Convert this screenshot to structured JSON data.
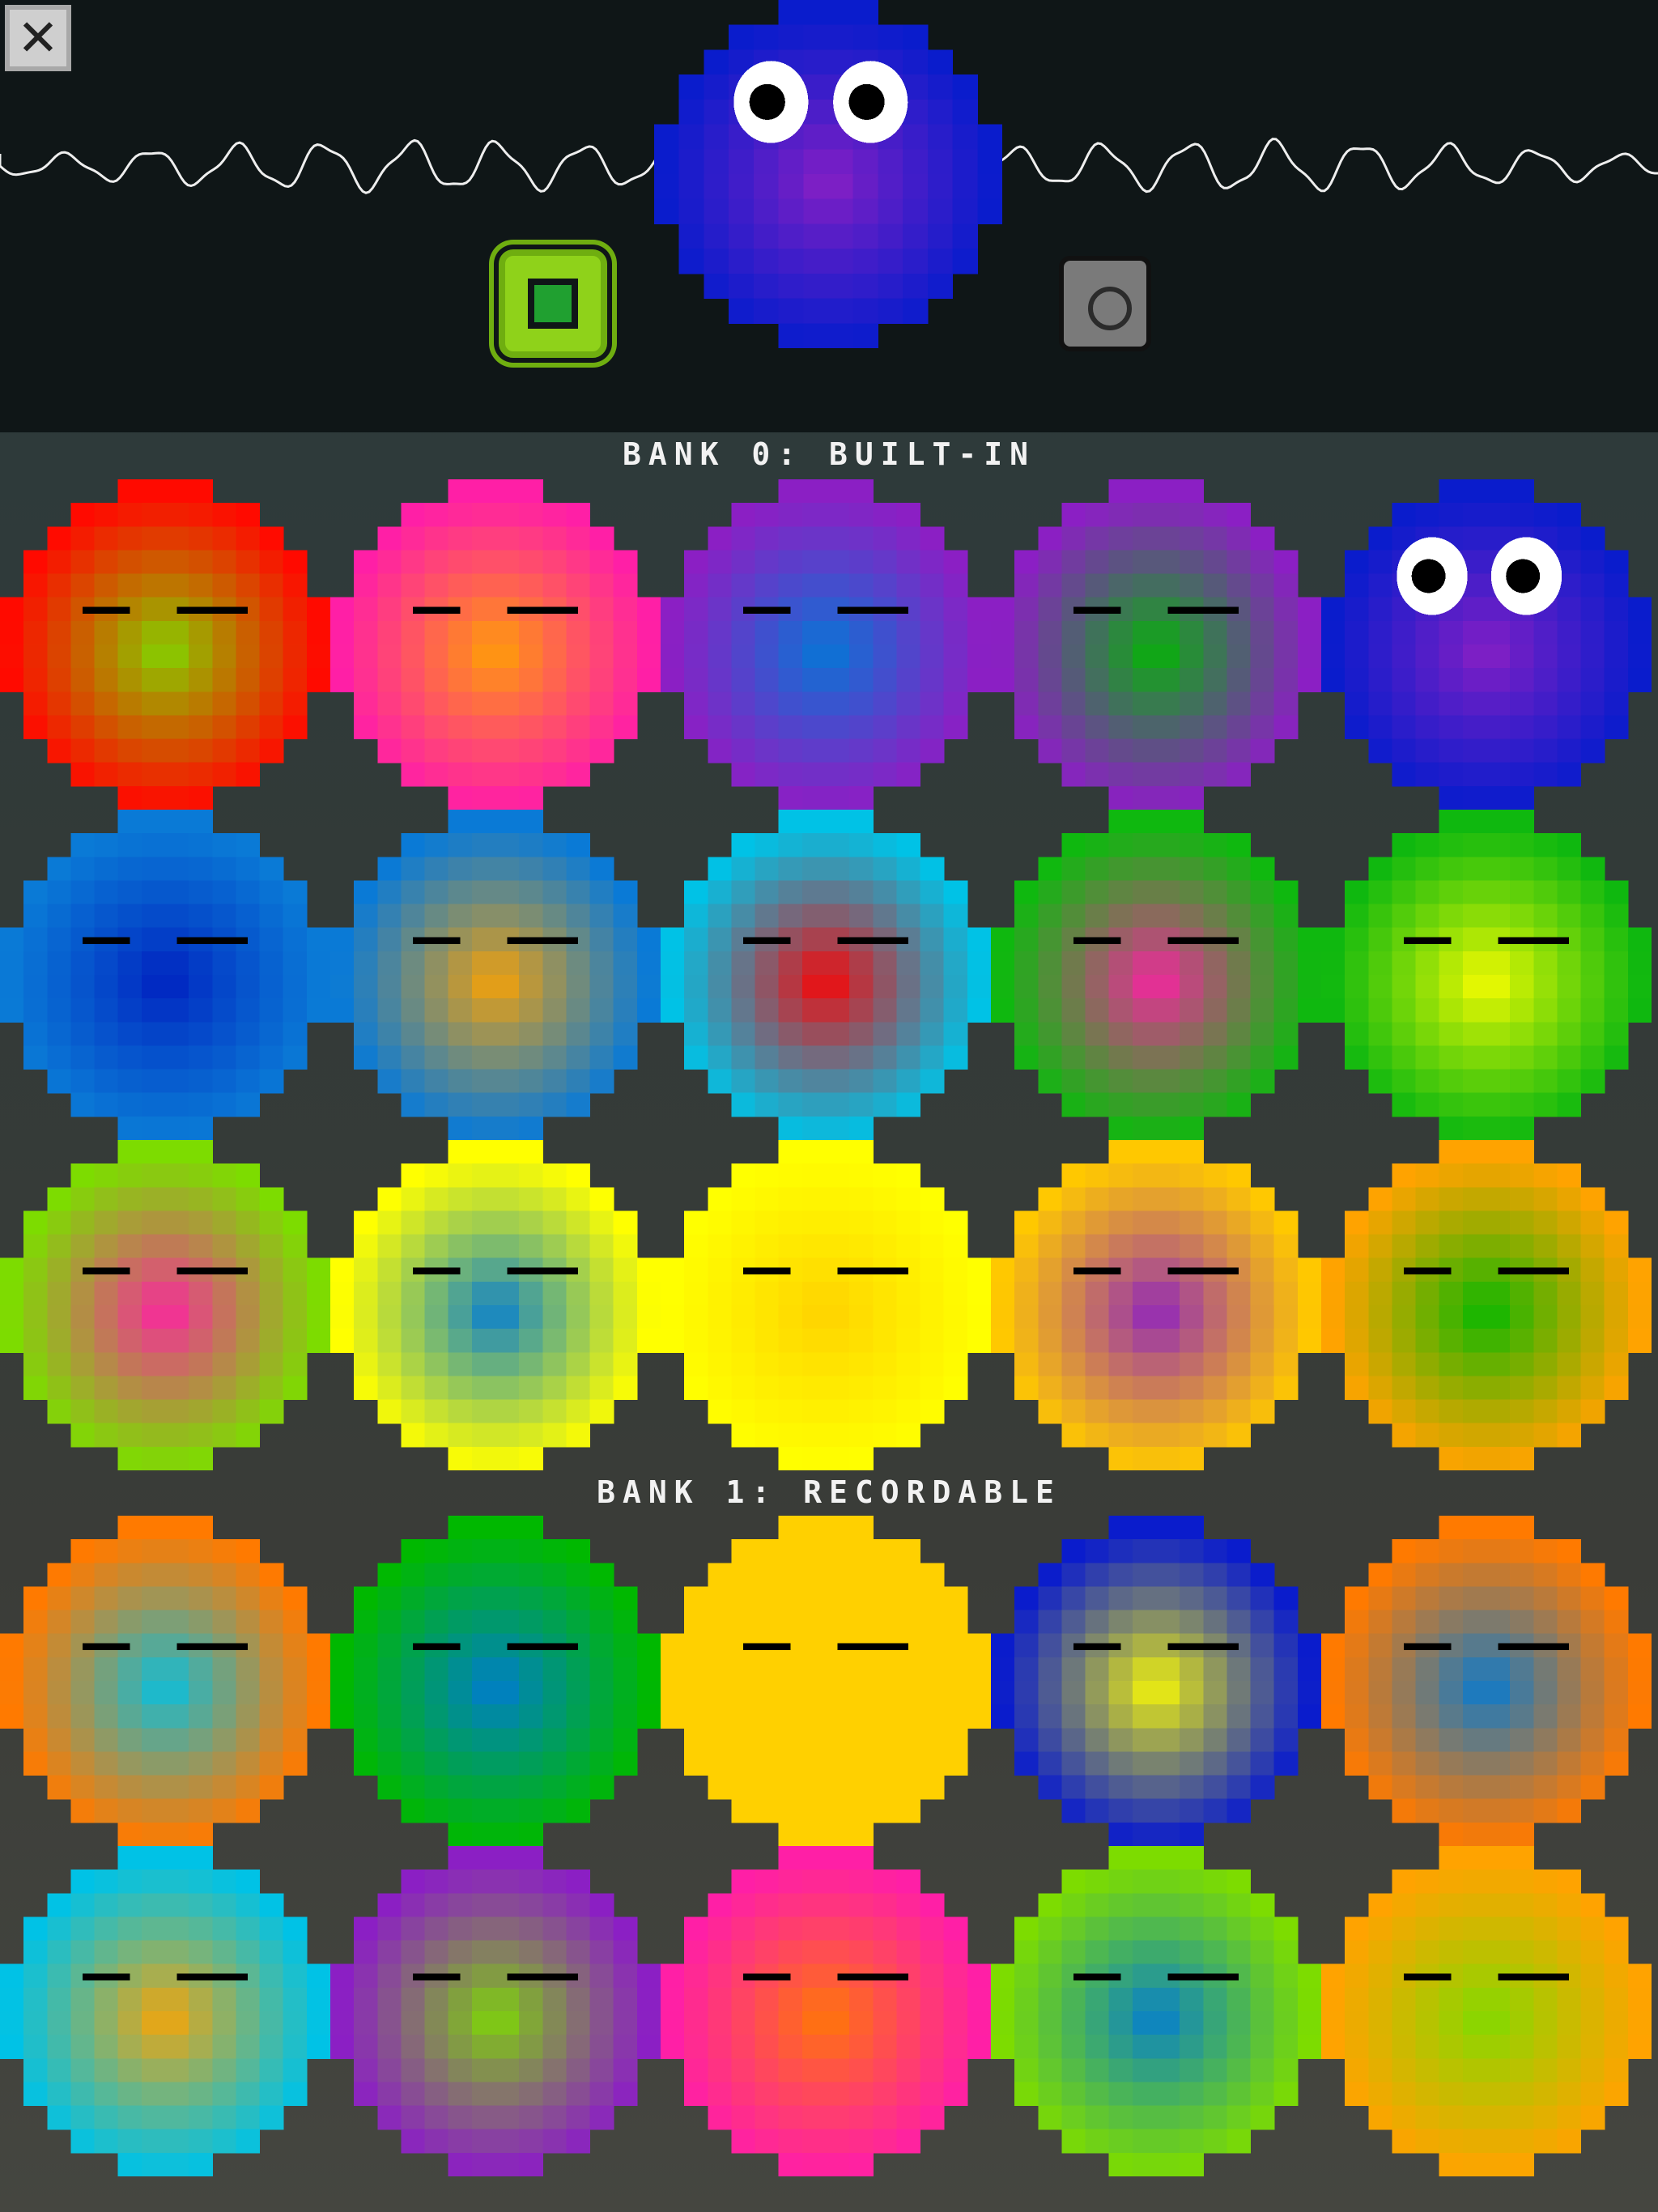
{
  "header": {
    "close_button": {
      "glyph": "✕",
      "icon": "close-icon"
    },
    "stop_button": {
      "icon": "stop-icon",
      "color": "#8fd21a"
    },
    "record_button": {
      "icon": "record-icon",
      "color": "#7a7a7a"
    },
    "active_sound": {
      "outer": "#0a1ccc",
      "inner": "#8b1fc4",
      "eyes": true
    }
  },
  "banks": [
    {
      "title": "BANK 0: BUILT-IN",
      "sounds": [
        {
          "outer": "#ff0a00",
          "inner": "#7ddc00",
          "eyes": false
        },
        {
          "outer": "#ff1fa6",
          "inner": "#ffa300",
          "eyes": false
        },
        {
          "outer": "#8b1fc4",
          "inner": "#007ad6",
          "eyes": false
        },
        {
          "outer": "#8b1fc4",
          "inner": "#00b800",
          "eyes": false
        },
        {
          "outer": "#0a1ccc",
          "inner": "#8b1fc4",
          "eyes": true
        },
        {
          "outer": "#0a7ad6",
          "inner": "#001fbf",
          "eyes": false
        },
        {
          "outer": "#0a7ad6",
          "inner": "#ffa300",
          "eyes": false
        },
        {
          "outer": "#00c2e6",
          "inner": "#ff0000",
          "eyes": false
        },
        {
          "outer": "#0fb80f",
          "inner": "#ff1fa6",
          "eyes": false
        },
        {
          "outer": "#0fb80f",
          "inner": "#ffff00",
          "eyes": false
        },
        {
          "outer": "#7ddc00",
          "inner": "#ff1fa6",
          "eyes": false
        },
        {
          "outer": "#ffff00",
          "inner": "#007ad6",
          "eyes": false
        },
        {
          "outer": "#ffff00",
          "inner": "#ffd000",
          "eyes": false
        },
        {
          "outer": "#ffc800",
          "inner": "#8b1fc4",
          "eyes": false
        },
        {
          "outer": "#ffa300",
          "inner": "#00b800",
          "eyes": false
        }
      ]
    },
    {
      "title": "BANK 1: RECORDABLE",
      "sounds": [
        {
          "outer": "#ff7a00",
          "inner": "#00c2e6",
          "eyes": false
        },
        {
          "outer": "#00b800",
          "inner": "#007ad6",
          "eyes": false
        },
        {
          "outer": "#ffd000",
          "inner": "#ffd000",
          "eyes": false
        },
        {
          "outer": "#0a1ccc",
          "inner": "#ffff00",
          "eyes": false
        },
        {
          "outer": "#ff7a00",
          "inner": "#007ad6",
          "eyes": false
        },
        {
          "outer": "#00c2e6",
          "inner": "#ffa300",
          "eyes": false
        },
        {
          "outer": "#8b1fc4",
          "inner": "#7ddc00",
          "eyes": false
        },
        {
          "outer": "#ff1fa6",
          "inner": "#ff7a00",
          "eyes": false
        },
        {
          "outer": "#7ddc00",
          "inner": "#007ad6",
          "eyes": false
        },
        {
          "outer": "#ffa300",
          "inner": "#7ddc00",
          "eyes": false
        }
      ]
    }
  ]
}
